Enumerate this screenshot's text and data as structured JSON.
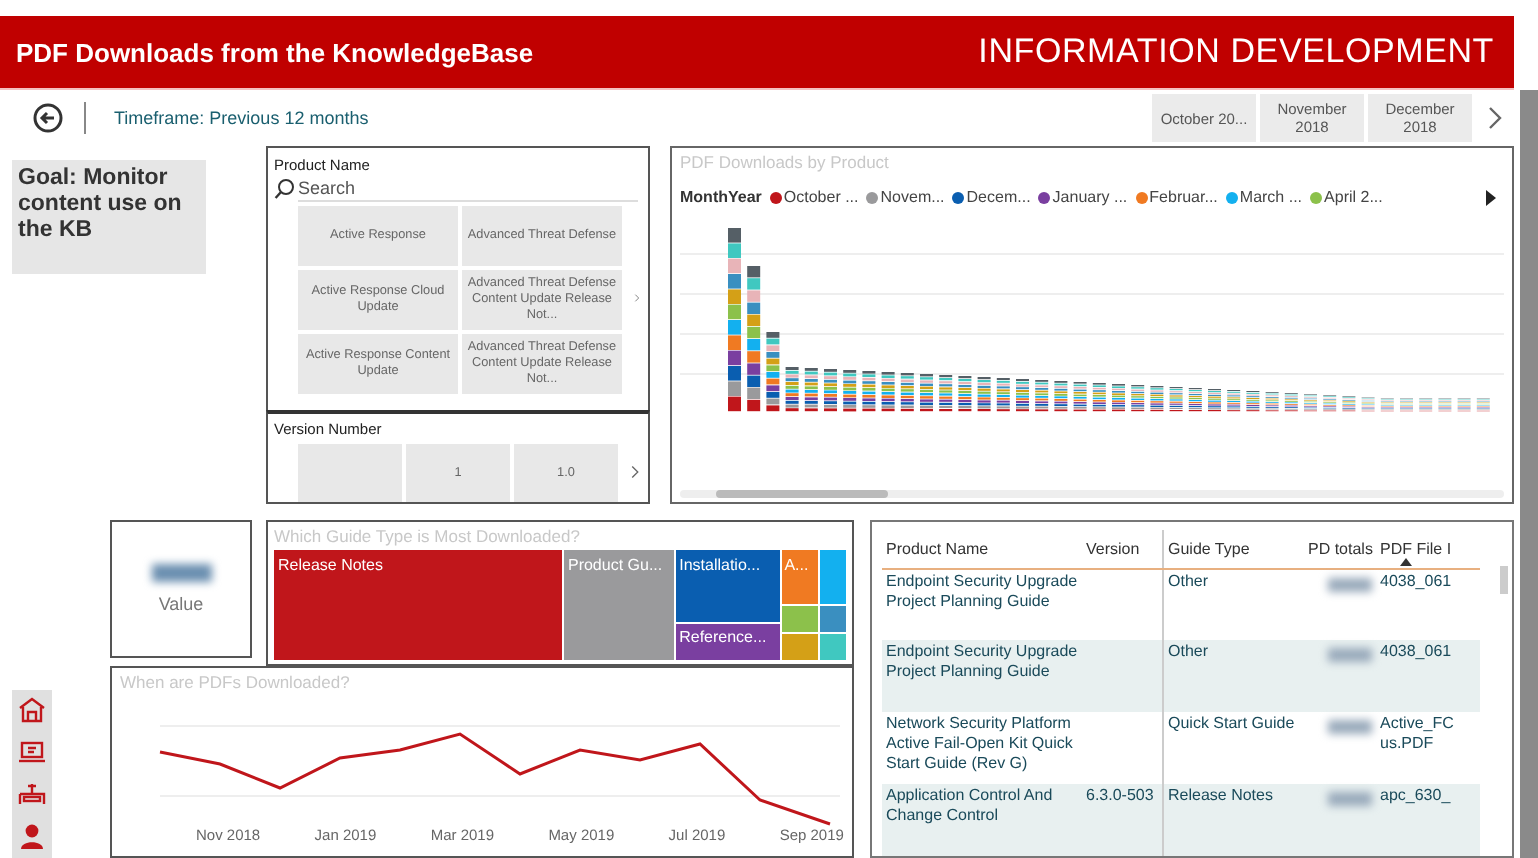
{
  "header": {
    "title": "PDF Downloads from the KnowledgeBase",
    "brand": "INFORMATION DEVELOPMENT"
  },
  "toolbar": {
    "timeframe": "Timeframe: Previous 12 months",
    "months": [
      "October 20...",
      "November 2018",
      "December 2018"
    ]
  },
  "goal": "Goal: Monitor content use on the KB",
  "product_slicer": {
    "label": "Product Name",
    "placeholder": "Search",
    "tiles": [
      "Active Response",
      "Active Response Cloud Update",
      "Active Response Content Update",
      "Advanced Threat Defense",
      "Advanced Threat Defense Content Update Release Not...",
      "Advanced Threat Defense Content Update Release Not..."
    ]
  },
  "version_slicer": {
    "label": "Version Number",
    "tiles": [
      {
        "kind": "blank"
      },
      {
        "kind": "value",
        "label": "1"
      },
      {
        "kind": "value",
        "label": "1.0"
      }
    ]
  },
  "bar_chart": {
    "title": "PDF Downloads by Product",
    "legend_title": "MonthYear",
    "legend": [
      {
        "label": "October ...",
        "color": "#c0161b"
      },
      {
        "label": "Novem...",
        "color": "#9a9a9c"
      },
      {
        "label": "Decem...",
        "color": "#0a5eb0"
      },
      {
        "label": "January ...",
        "color": "#7a3fa0"
      },
      {
        "label": "Februar...",
        "color": "#f07a22"
      },
      {
        "label": "March ...",
        "color": "#13b0ef"
      },
      {
        "label": "April 2...",
        "color": "#8cc14b"
      }
    ]
  },
  "value_card": {
    "label": "Value"
  },
  "treemap": {
    "title": "Which Guide Type is Most Downloaded?",
    "columns": [
      {
        "tiles": [
          {
            "label": "Release Notes",
            "color": "#c0161b"
          }
        ]
      },
      {
        "tiles": [
          {
            "label": "Product Gu...",
            "color": "#9a9a9c"
          }
        ]
      },
      {
        "tiles": [
          {
            "label": "Installatio...",
            "color": "#0a5eb0"
          },
          {
            "label": "Reference...",
            "color": "#7a3fa0"
          }
        ]
      },
      {
        "tiles": [
          {
            "label": "A...",
            "color": "#f07a22"
          },
          {
            "color": "#8cc14b"
          },
          {
            "color": "#d4a017"
          }
        ]
      },
      {
        "tiles": [
          {
            "color": "#13b0ef"
          },
          {
            "color": "#3a8fc0"
          },
          {
            "color": "#40c8c0"
          }
        ]
      }
    ]
  },
  "line_chart": {
    "title": "When are PDFs Downloaded?",
    "x_labels": [
      "Nov 2018",
      "Jan 2019",
      "Mar 2019",
      "May 2019",
      "Jul 2019",
      "Sep 2019"
    ]
  },
  "table": {
    "columns": [
      {
        "label": "Product Name",
        "sorted": false
      },
      {
        "label": "Version",
        "sorted": false
      },
      {
        "label": "Guide Type",
        "sorted": false
      },
      {
        "label": "PD totals",
        "sorted": false
      },
      {
        "label": "PDF File I",
        "sorted": true
      }
    ],
    "rows": [
      {
        "product": "Endpoint Security Upgrade Project Planning Guide",
        "guide_type": "Other",
        "pdf_file": "4038_061"
      },
      {
        "product": "Endpoint Security Upgrade Project Planning Guide",
        "guide_type": "Other",
        "pdf_file": "4038_061"
      },
      {
        "product": "Network Security Platform Active Fail-Open Kit Quick Start Guide (Rev G)",
        "guide_type": "Quick Start Guide",
        "pdf_file": "Active_FC us.PDF"
      },
      {
        "product": "Application Control And Change Control",
        "version": "6.3.0-503",
        "guide_type": "Release Notes",
        "pdf_file": "apc_630_"
      }
    ]
  }
}
